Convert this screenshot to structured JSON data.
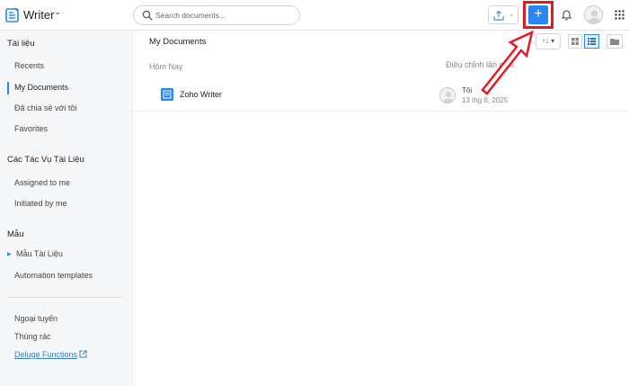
{
  "header": {
    "app_name": "Writer",
    "search": {
      "placeholder": "Search documents..."
    },
    "new_button_symbol": "+",
    "icons": [
      "writer-logo-icon",
      "chevron-down-icon",
      "search-icon",
      "upload-icon",
      "plus-icon",
      "bell-icon",
      "avatar",
      "apps-grid-icon"
    ]
  },
  "sidebar": {
    "section1": {
      "title": "Tài liệu",
      "items": [
        "Recents",
        "My Documents",
        "Đã chia sẻ với tôi",
        "Favorites"
      ],
      "active_index": 1
    },
    "section2": {
      "title": "Các Tác Vụ Tài Liệu",
      "items": [
        "Assigned to me",
        "Initiated by me"
      ]
    },
    "section3": {
      "title": "Mẫu",
      "items": [
        "Mẫu Tài Liệu",
        "Automation templates"
      ]
    },
    "bottom": {
      "items": [
        "Ngoại tuyến",
        "Thùng rác"
      ],
      "link": "Deluge Functions"
    }
  },
  "main": {
    "title": "My Documents",
    "sort_label": "↑↓ ▾",
    "columns": {
      "today": "Hôm Nay",
      "edited": "Điều chỉnh lần cuối"
    },
    "rows": [
      {
        "name": "Zoho Writer",
        "owner": "Tôi",
        "date": "13 thg 8, 2025"
      }
    ]
  },
  "colors": {
    "accent": "#2a86f0",
    "highlight": "#e11b22",
    "sidebar_bg": "#f6f7f9"
  }
}
